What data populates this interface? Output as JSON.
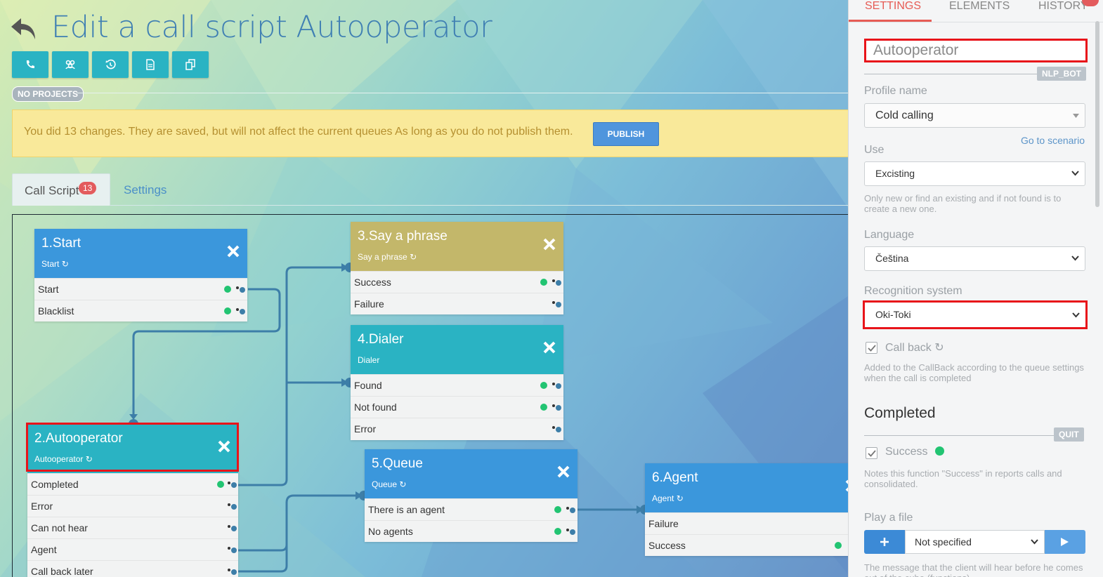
{
  "header": {
    "title": "Edit a call script Autooperator",
    "project_badge": "NO PROJECTS"
  },
  "toolbar": {
    "buttons": [
      "phone-icon",
      "group-icon",
      "history-icon",
      "document-icon",
      "copy-icon"
    ]
  },
  "alert": {
    "message": "You did 13 changes. They are saved, but will not affect the current queues As long as you do not publish them.",
    "publish_label": "PUBLISH"
  },
  "tabs": {
    "call_script": "Call Script",
    "call_script_count": "13",
    "settings": "Settings"
  },
  "nodes": {
    "start": {
      "title": "1.Start",
      "subtitle": "Start",
      "rows": [
        "Start",
        "Blacklist"
      ]
    },
    "autooperator": {
      "title": "2.Autooperator",
      "subtitle": "Autooperator",
      "rows": [
        "Completed",
        "Error",
        "Can not hear",
        "Agent",
        "Call back later"
      ]
    },
    "say": {
      "title": "3.Say a phrase",
      "subtitle": "Say a phrase",
      "rows": [
        "Success",
        "Failure"
      ]
    },
    "dialer": {
      "title": "4.Dialer",
      "subtitle": "Dialer",
      "rows": [
        "Found",
        "Not found",
        "Error"
      ]
    },
    "queue": {
      "title": "5.Queue",
      "subtitle": "Queue",
      "rows": [
        "There is an agent",
        "No agents"
      ]
    },
    "agent": {
      "title": "6.Agent",
      "subtitle": "Agent",
      "rows": [
        "Failure",
        "Success"
      ]
    }
  },
  "colors": {
    "blue_node": "#3b97dc",
    "teal_node": "#2ab3c3",
    "olive_node": "#c3b76a",
    "connector": "#3d7ea8",
    "accent": "#e65c55",
    "highlight": "#e8141a"
  },
  "panel": {
    "tabs": [
      "SETTINGS",
      "ELEMENTS",
      "HISTORY"
    ],
    "name_value": "Autooperator",
    "name_badge": "NLP_BOT",
    "profile_label": "Profile name",
    "profile_value": "Cold calling",
    "go_to_scenario": "Go to scenario",
    "use_label": "Use",
    "use_value": "Excisting",
    "use_help": "Only new or find an existing and if not found is to create a new one.",
    "language_label": "Language",
    "language_value": "Čeština",
    "recognition_label": "Recognition system",
    "recognition_value": "Oki-Toki",
    "callback_label": "Call back",
    "callback_help": "Added to the CallBack according to the queue settings when the call is completed",
    "completed_title": "Completed",
    "completed_badge": "QUIT",
    "success_label": "Success",
    "success_help": "Notes this function \"Success\" in reports calls and consolidated.",
    "play_label": "Play a file",
    "play_value": "Not specified",
    "play_help": "The message that the client will hear before he comes out of the cube (functions)"
  }
}
